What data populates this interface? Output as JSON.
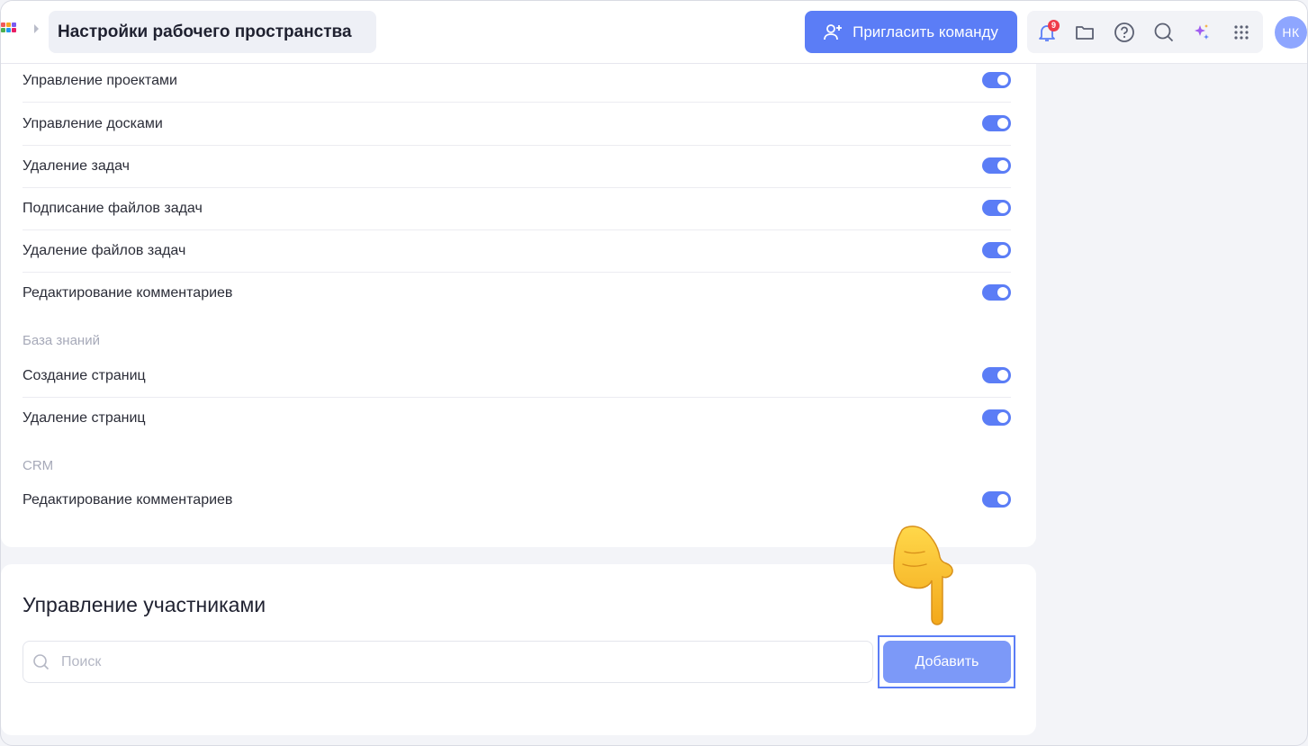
{
  "header": {
    "breadcrumb_title": "Настройки рабочего пространства",
    "invite_label": "Пригласить команду",
    "notification_count": "9",
    "avatar_initials": "НК",
    "icons": [
      "bell-icon",
      "folder-icon",
      "help-icon",
      "search-icon",
      "sparkles-icon",
      "apps-grid-icon"
    ]
  },
  "permissions": {
    "projects_rows": [
      {
        "label": "Управление проектами",
        "enabled": true
      },
      {
        "label": "Управление досками",
        "enabled": true
      },
      {
        "label": "Удаление задач",
        "enabled": true
      },
      {
        "label": "Подписание файлов задач",
        "enabled": true
      },
      {
        "label": "Удаление файлов задач",
        "enabled": true
      },
      {
        "label": "Редактирование комментариев",
        "enabled": true
      }
    ],
    "kb_title": "База знаний",
    "kb_rows": [
      {
        "label": "Создание страниц",
        "enabled": true
      },
      {
        "label": "Удаление страниц",
        "enabled": true
      }
    ],
    "crm_title": "CRM",
    "crm_rows": [
      {
        "label": "Редактирование комментариев",
        "enabled": true
      }
    ]
  },
  "members": {
    "title": "Управление участниками",
    "search_placeholder": "Поиск",
    "add_label": "Добавить"
  },
  "colors": {
    "accent": "#5b7df6",
    "accent_light": "#7c99f8",
    "badge": "#ef3b4a"
  }
}
